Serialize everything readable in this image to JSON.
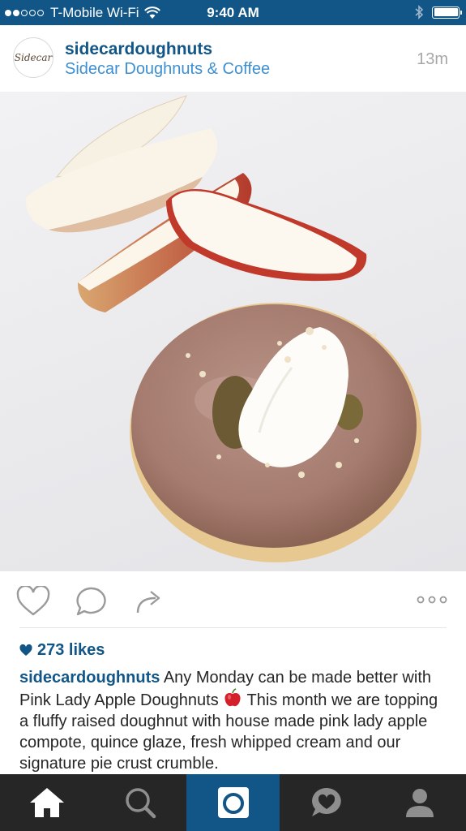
{
  "status_bar": {
    "carrier": "T-Mobile Wi-Fi",
    "time": "9:40 AM",
    "signal_dots_filled": 2,
    "signal_dots_total": 5,
    "battery_level": 1.0
  },
  "post": {
    "avatar_text": "Sidecar",
    "username": "sidecardoughnuts",
    "location": "Sidecar Doughnuts & Coffee",
    "time_ago": "13m",
    "photo_alt": "",
    "likes": "273 likes",
    "caption": {
      "username": "sidecardoughnuts",
      "text_before_emoji": " Any Monday can be made better with Pink Lady Apple Doughnuts ",
      "text_after_emoji": " This month we are topping a fluffy raised doughnut with house made pink lady apple compote, quince glaze, fresh whipped cream and our signature pie crust crumble."
    }
  },
  "actions": {
    "icons": [
      "heart-icon",
      "comment-icon",
      "share-icon",
      "more-icon"
    ]
  },
  "tab_bar": {
    "tabs": [
      {
        "icon": "home-icon",
        "active": false
      },
      {
        "icon": "search-icon",
        "active": false
      },
      {
        "icon": "camera-icon",
        "active": true
      },
      {
        "icon": "activity-icon",
        "active": false
      },
      {
        "icon": "profile-icon",
        "active": false
      }
    ]
  },
  "colors": {
    "brand_blue": "#125688",
    "link_blue": "#3d8fd1",
    "tab_bar_bg": "#262626"
  }
}
